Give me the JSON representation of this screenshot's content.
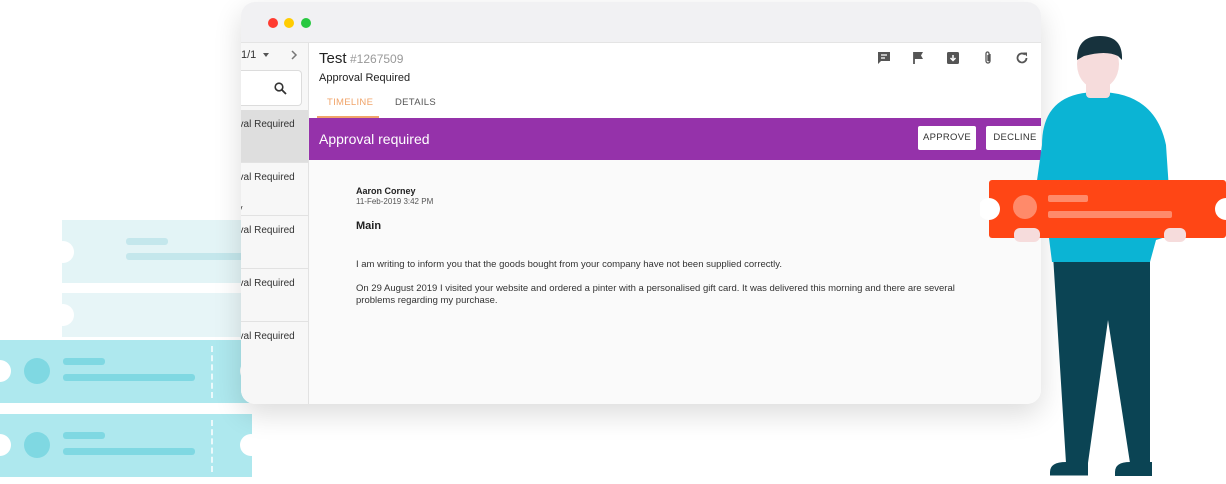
{
  "window": {
    "traffic_lights": {
      "close": "#ff3b30",
      "minimize": "#ffcc00",
      "maximize": "#28c840"
    }
  },
  "sidebar": {
    "pager": "1/1",
    "items": [
      {
        "label": "oval Required",
        "active": true
      },
      {
        "label": "oval Required",
        "active": false,
        "extra": "y"
      },
      {
        "label": "oval Required",
        "active": false
      },
      {
        "label": "oval Required",
        "active": false
      },
      {
        "label": "oval Required",
        "active": false
      }
    ]
  },
  "header": {
    "title": "Test",
    "ticket_id": "#1267509",
    "status": "Approval Required",
    "tabs": [
      {
        "label": "TIMELINE",
        "active": true
      },
      {
        "label": "DETAILS",
        "active": false
      }
    ],
    "toolbar_icons": [
      "comment-icon",
      "flag-icon",
      "archive-icon",
      "attachment-icon",
      "refresh-icon"
    ]
  },
  "banner": {
    "text": "Approval required",
    "approve_label": "APPROVE",
    "decline_label": "DECLINE",
    "color": "#9532aa"
  },
  "message": {
    "author": "Aaron Corney",
    "date": "11-Feb-2019 3:42 PM",
    "subject": "Main",
    "paragraphs": [
      "I am writing to inform you that the goods bought from your company have not been supplied correctly.",
      "On 29 August 2019 I visited your website and ordered a pinter with a personalised gift card. It was delivered this morning and there are several problems regarding my purchase."
    ]
  },
  "colors": {
    "accent_tab": "#f0a46a",
    "ticket_orange": "#ff4615",
    "ticket_cyan": "#aee8ee",
    "person_shirt": "#0bb4d4",
    "person_pants": "#0b4454"
  }
}
